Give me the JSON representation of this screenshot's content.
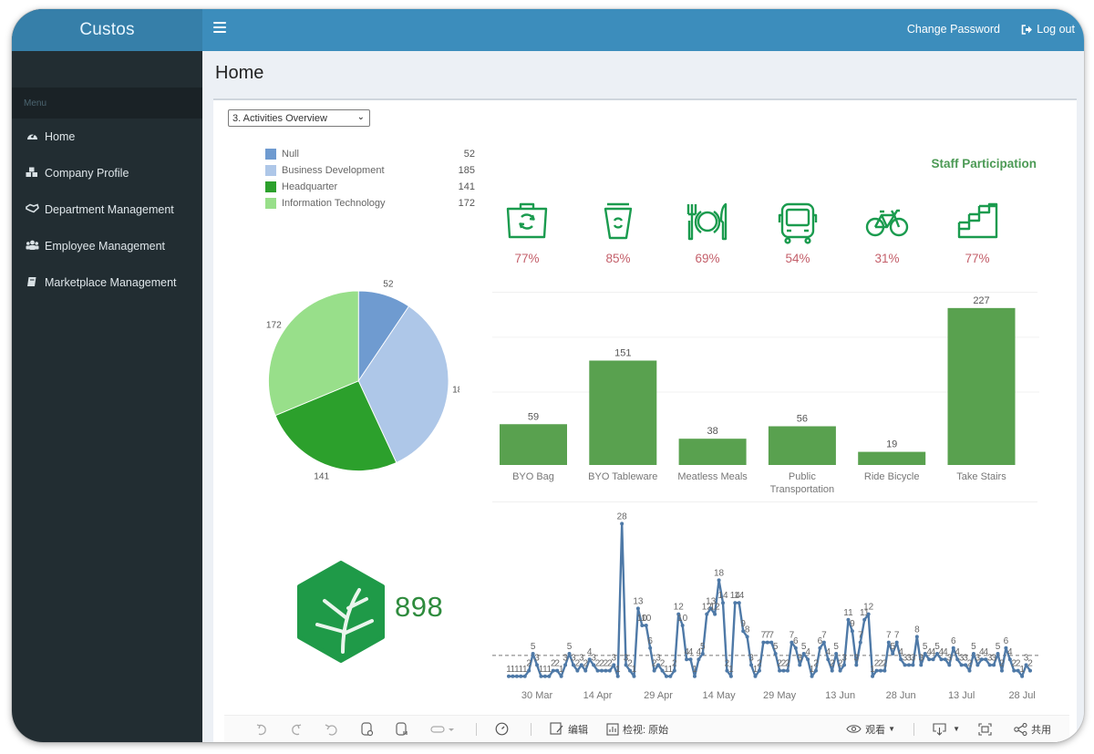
{
  "app": {
    "brand": "Custos",
    "topbar": {
      "change_password": "Change Password",
      "logout": "Log out"
    }
  },
  "sidebar": {
    "menu_header": "Menu",
    "items": [
      {
        "label": "Home",
        "icon": "dashboard-icon"
      },
      {
        "label": "Company Profile",
        "icon": "cubes-icon"
      },
      {
        "label": "Department Management",
        "icon": "handshake-icon"
      },
      {
        "label": "Employee Management",
        "icon": "users-icon"
      },
      {
        "label": "Marketplace Management",
        "icon": "book-icon"
      }
    ]
  },
  "page": {
    "title": "Home",
    "view_select": {
      "selected": "3. Activities Overview"
    }
  },
  "colors": {
    "topbar": "#3c8dbc",
    "brand_bg": "#367fa9",
    "sidebar_bg": "#222d32",
    "bar_green": "#59a14f",
    "line_blue": "#4e79a7",
    "pct_red": "#c4606b",
    "icon_green": "#1a9b4e"
  },
  "staff_participation": {
    "title": "Staff Participation",
    "items": [
      {
        "icon": "reusable-bag-icon",
        "percent": "77%"
      },
      {
        "icon": "reusable-cup-icon",
        "percent": "85%"
      },
      {
        "icon": "plate-cutlery-icon",
        "percent": "69%"
      },
      {
        "icon": "bus-icon",
        "percent": "54%"
      },
      {
        "icon": "bicycle-icon",
        "percent": "31%"
      },
      {
        "icon": "stairs-icon",
        "percent": "77%"
      }
    ]
  },
  "total": {
    "value": "898",
    "icon": "leaf-hexagon-icon"
  },
  "chart_data": [
    {
      "type": "pie",
      "title": "",
      "legend_position": "top",
      "categories": [
        "Null",
        "Business Development",
        "Headquarter",
        "Information Technology"
      ],
      "values": [
        52,
        185,
        141,
        172
      ],
      "colors": [
        "#6f9bd0",
        "#aec7e8",
        "#2ca02c",
        "#98df8a"
      ]
    },
    {
      "type": "bar",
      "title": "",
      "categories": [
        "BYO Bag",
        "BYO Tableware",
        "Meatless Meals",
        "Public Transportation",
        "Ride Bicycle",
        "Take Stairs"
      ],
      "values": [
        59,
        151,
        38,
        56,
        19,
        227
      ],
      "xlabel": "",
      "ylabel": "",
      "ylim": [
        0,
        240
      ],
      "color": "#59a14f"
    },
    {
      "type": "line",
      "title": "",
      "x_tick_labels": [
        "30 Mar",
        "14 Apr",
        "29 Apr",
        "14 May",
        "29 May",
        "13 Jun",
        "28 Jun",
        "13 Jul",
        "28 Jul"
      ],
      "x_start": "2023-03-23",
      "values": [
        1,
        1,
        1,
        1,
        1,
        2,
        5,
        3,
        1,
        1,
        1,
        2,
        2,
        1,
        3,
        5,
        3,
        2,
        3,
        2,
        4,
        3,
        2,
        2,
        2,
        2,
        3,
        1,
        28,
        3,
        2,
        1,
        13,
        10,
        10,
        6,
        2,
        3,
        2,
        1,
        1,
        2,
        12,
        10,
        4,
        4,
        1,
        4,
        5,
        12,
        13,
        12,
        18,
        14,
        2,
        1,
        14,
        14,
        9,
        8,
        3,
        1,
        2,
        7,
        7,
        7,
        5,
        2,
        2,
        2,
        7,
        6,
        3,
        5,
        4,
        1,
        2,
        6,
        7,
        4,
        2,
        5,
        2,
        3,
        11,
        9,
        3,
        7,
        11,
        12,
        1,
        2,
        2,
        2,
        7,
        5,
        7,
        4,
        3,
        3,
        3,
        8,
        3,
        5,
        4,
        4,
        5,
        4,
        4,
        3,
        6,
        4,
        3,
        3,
        2,
        5,
        3,
        4,
        4,
        3,
        3,
        5,
        2,
        6,
        4,
        2,
        2,
        1,
        3,
        2
      ],
      "reference_line": 4.7,
      "ylim": [
        0,
        30
      ],
      "color": "#4e79a7"
    }
  ],
  "toolbar": {
    "undo": "undo-icon",
    "redo": "redo-icon",
    "revert": "revert-icon",
    "edit_label": "编辑",
    "view_label": "检视: 原始",
    "watch_label": "观看",
    "share_label": "共用"
  }
}
